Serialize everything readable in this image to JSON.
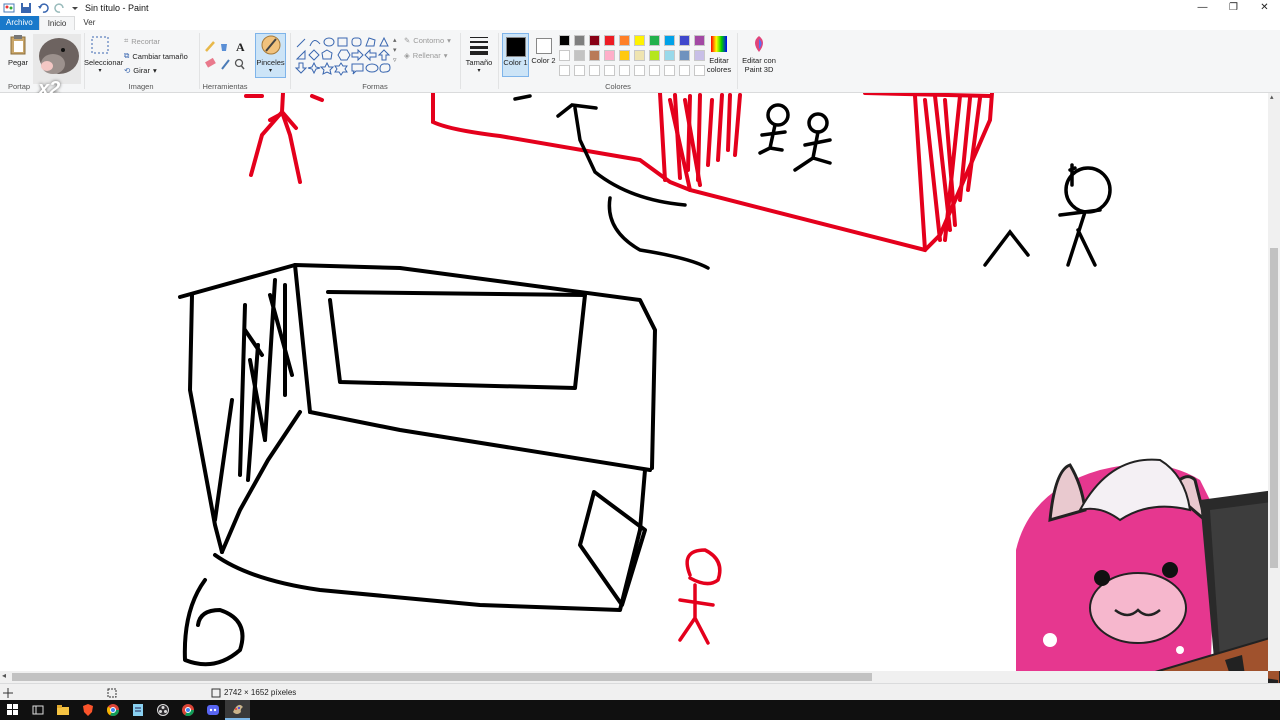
{
  "window": {
    "title": "Sin título - Paint",
    "controls": [
      "—",
      "❐",
      "✕"
    ]
  },
  "quick_access": {
    "icons": [
      "paint-app-icon",
      "save-icon",
      "undo-icon",
      "redo-icon",
      "customize-icon"
    ]
  },
  "tabs": {
    "file": "Archivo",
    "home": "Inicio",
    "view": "Ver"
  },
  "ribbon": {
    "clipboard": {
      "paste": "Pegar",
      "label": "Portap"
    },
    "image": {
      "select": "Seleccionar",
      "crop": "Recortar",
      "resize": "Cambiar tamaño",
      "rotate": "Girar",
      "label": "Imagen"
    },
    "tools": {
      "label": "Herramientas"
    },
    "brushes": {
      "label": "Pinceles"
    },
    "shapes": {
      "outline": "Contorno",
      "fill": "Rellenar",
      "label": "Formas"
    },
    "size": {
      "label": "Tamaño"
    },
    "colors": {
      "color1": "Color 1",
      "color2": "Color 2",
      "edit": "Editar colores",
      "label": "Colores",
      "palette_row1": [
        "#000000",
        "#7f7f7f",
        "#880015",
        "#ed1c24",
        "#ff7f27",
        "#fff200",
        "#22b14c",
        "#00a2e8",
        "#3f48cc",
        "#a349a4"
      ],
      "palette_row2": [
        "#ffffff",
        "#c3c3c3",
        "#b97a57",
        "#ffaec9",
        "#ffc90e",
        "#efe4b0",
        "#b5e61d",
        "#99d9ea",
        "#7092be",
        "#c8bfe7"
      ]
    },
    "paint3d": "Editar con Paint 3D"
  },
  "overlay": {
    "cat_text": "x2"
  },
  "status": {
    "dimensions": "2742 × 1652 píxeles"
  },
  "taskbar": {
    "icons": [
      "windows-start-icon",
      "task-view-icon",
      "file-explorer-icon",
      "brave-browser-icon",
      "chrome-icon",
      "notepad-icon",
      "obs-icon",
      "chrome-alt-icon",
      "discord-icon",
      "paint-taskbar-icon"
    ]
  }
}
